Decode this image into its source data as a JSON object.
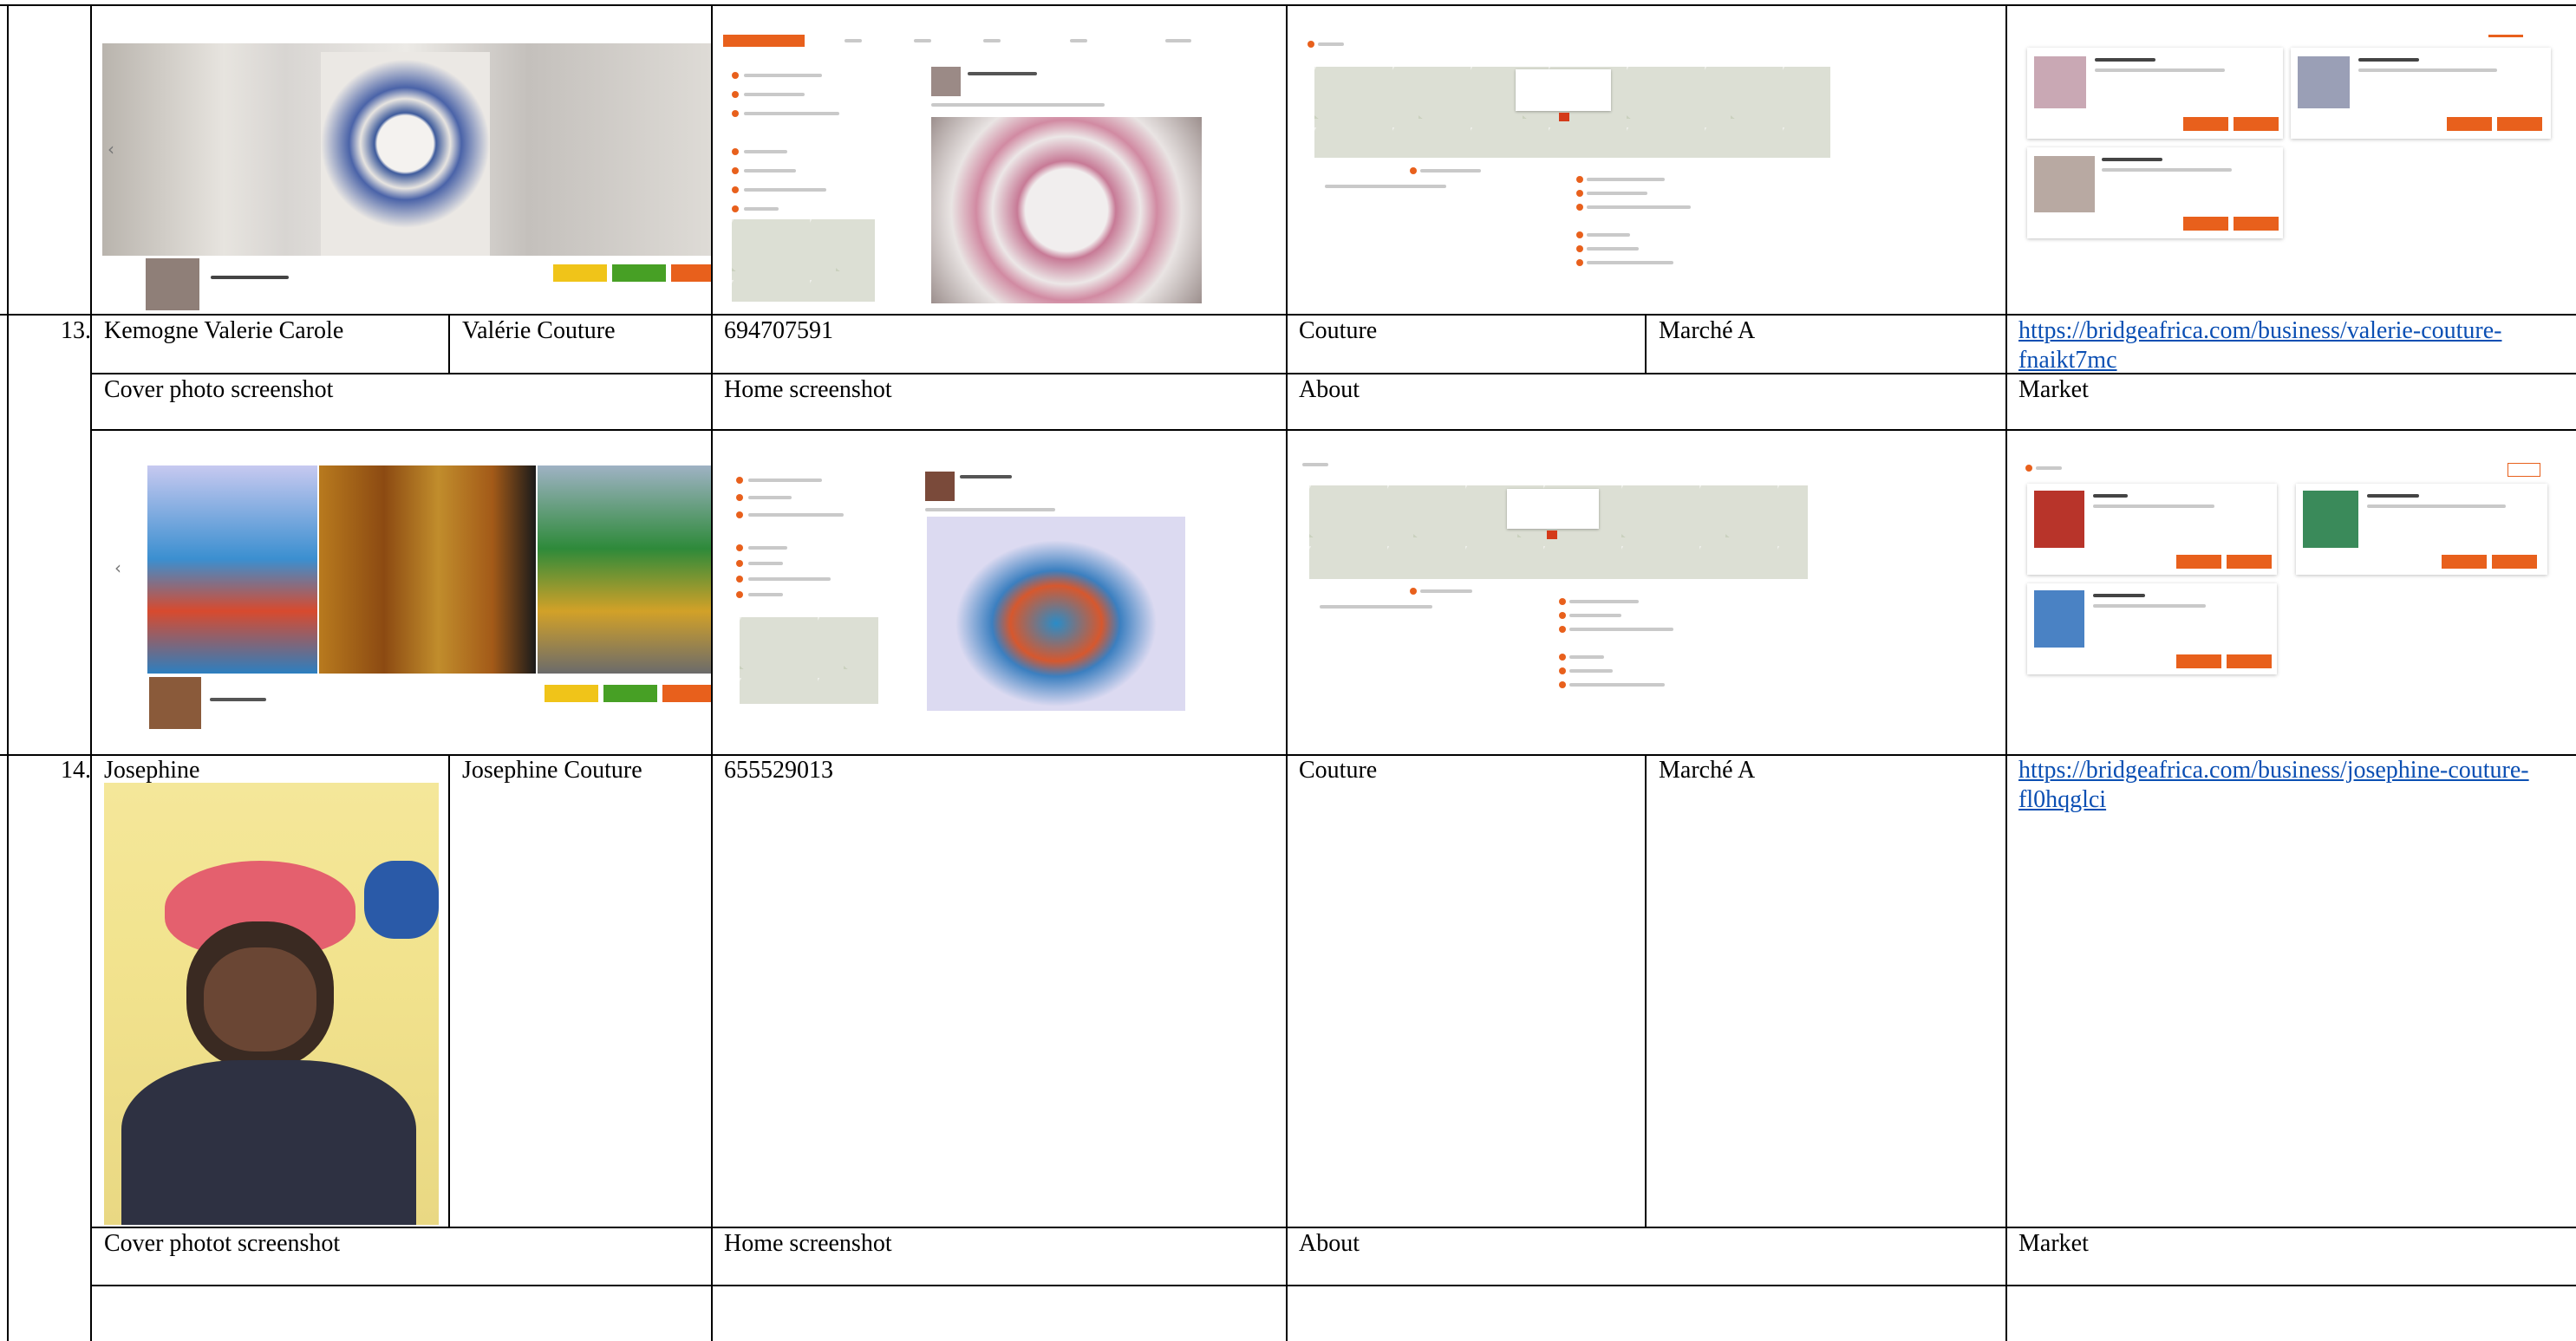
{
  "rows": [
    {
      "number": "13.",
      "name": "Kemogne Valerie Carole",
      "business": "Valérie Couture",
      "phone": "694707591",
      "category": "Couture",
      "market": "Marché A",
      "link": "https://bridgeafrica.com/business/valerie-couture-fnaikt7mc",
      "section_labels": [
        "Cover photo screenshot",
        "Home screenshot",
        "About",
        "Market"
      ]
    },
    {
      "number": "14.",
      "name": "Josephine",
      "business": "Josephine Couture",
      "phone": "655529013",
      "category": "Couture",
      "market": "Marché A",
      "link": "https://bridgeafrica.com/business/josephine-couture-fl0hqglci",
      "section_labels": [
        "Cover photot screenshot",
        "Home screenshot",
        "About",
        "Market"
      ]
    }
  ],
  "colors": {
    "accent": "#e8601c",
    "link": "#0b4fb3",
    "yellow": "#f0c419",
    "green": "#47a025"
  }
}
